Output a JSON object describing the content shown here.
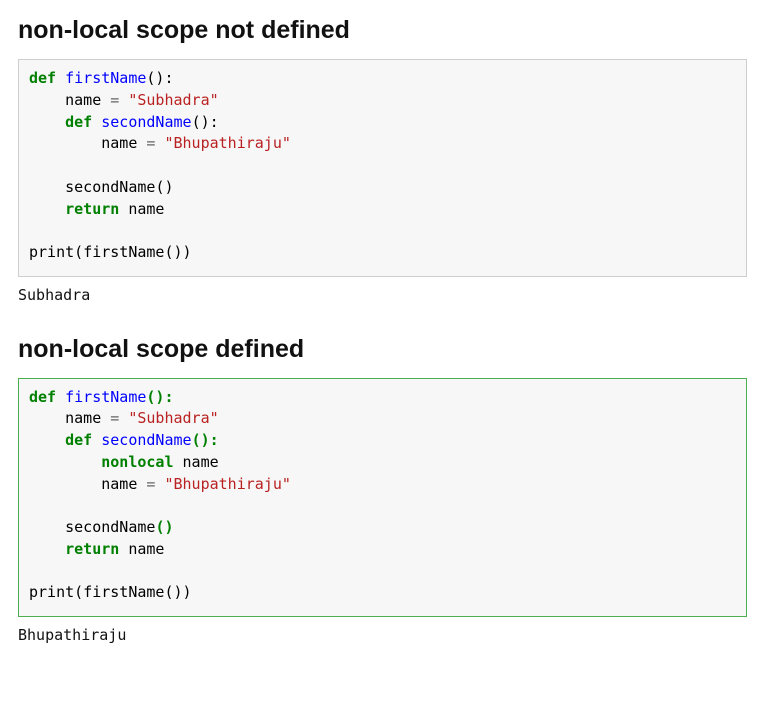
{
  "section1": {
    "title": "non-local scope not defined",
    "code": "<span class=\"kw\">def</span> <span class=\"fn\">firstName</span><span class=\"pn\">():</span>\n    name <span class=\"op\">=</span> <span class=\"str\">\"Subhadra\"</span>\n    <span class=\"kw\">def</span> <span class=\"fn\">secondName</span><span class=\"pn\">():</span>\n        name <span class=\"op\">=</span> <span class=\"str\">\"Bhupathiraju\"</span>\n\n    secondName<span class=\"pn\">()</span>\n    <span class=\"kw\">return</span> name\n\n<span class=\"id\">print</span><span class=\"pn\">(</span>firstName<span class=\"pn\">())</span>",
    "output": "Subhadra"
  },
  "section2": {
    "title": "non-local scope defined",
    "code": "<span class=\"kw\">def</span> <span class=\"fn\">firstName</span><span class=\"pn2\">():</span>\n    name <span class=\"op\">=</span> <span class=\"str\">\"Subhadra\"</span>\n    <span class=\"kw\">def</span> <span class=\"fn\">secondName</span><span class=\"pn2\">():</span>\n        <span class=\"kw\">nonlocal</span> name\n        name <span class=\"op\">=</span> <span class=\"str\">\"Bhupathiraju\"</span>\n\n    secondName<span class=\"pn2\">()</span>\n    <span class=\"kw\">return</span> name\n\n<span class=\"id\">print</span><span class=\"pn\">(</span>firstName<span class=\"pn\">())</span>",
    "output": "Bhupathiraju"
  }
}
